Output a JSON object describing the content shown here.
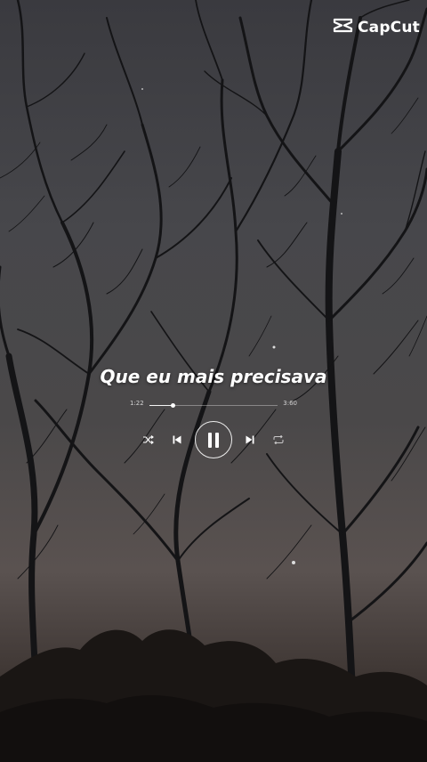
{
  "watermark": {
    "brand": "CapCut",
    "icon": "capcut-logo-icon"
  },
  "lyric": {
    "line": "Que eu mais precisava"
  },
  "player": {
    "elapsed": "1:22",
    "total": "3:60",
    "progress_fraction": 0.18,
    "controls": {
      "shuffle_icon": "shuffle-icon",
      "previous_icon": "previous-icon",
      "play_state_icon": "pause-icon",
      "next_icon": "next-icon",
      "repeat_icon": "repeat-icon"
    }
  },
  "colors": {
    "text": "#ffffff",
    "sky_top": "#3a3a3f",
    "sky_horizon": "#5a5250"
  }
}
